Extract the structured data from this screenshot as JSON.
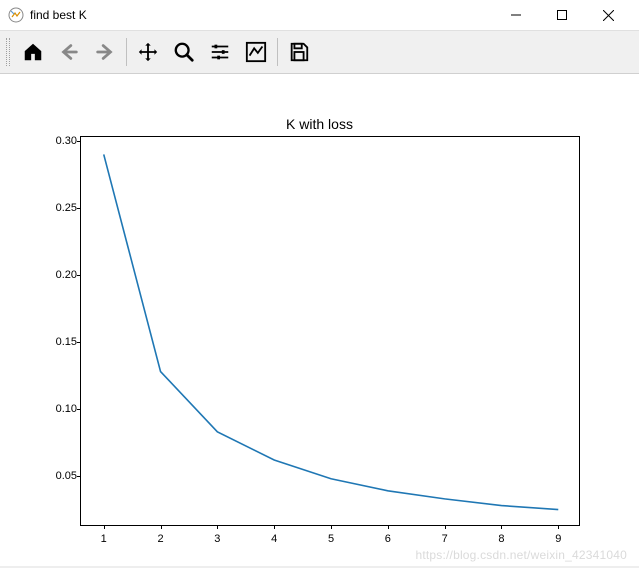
{
  "window": {
    "title": "find best K"
  },
  "toolbar": {
    "home": "home-icon",
    "back": "back-icon",
    "forward": "forward-icon",
    "pan": "pan-icon",
    "zoom": "zoom-icon",
    "subplots": "subplots-icon",
    "axes": "axes-icon",
    "save": "save-icon"
  },
  "watermark": "https://blog.csdn.net/weixin_42341040",
  "chart_data": {
    "type": "line",
    "title": "K with loss",
    "xlabel": "",
    "ylabel": "",
    "x": [
      1,
      2,
      3,
      4,
      5,
      6,
      7,
      8,
      9
    ],
    "y": [
      0.29,
      0.128,
      0.083,
      0.062,
      0.048,
      0.039,
      0.033,
      0.028,
      0.025
    ],
    "xlim": [
      0.6,
      9.4
    ],
    "ylim": [
      0.012,
      0.303
    ],
    "xticks": [
      1,
      2,
      3,
      4,
      5,
      6,
      7,
      8,
      9
    ],
    "yticks": [
      0.05,
      0.1,
      0.15,
      0.2,
      0.25,
      0.3
    ],
    "ytick_labels": [
      "0.05",
      "0.10",
      "0.15",
      "0.20",
      "0.25",
      "0.30"
    ],
    "line_color": "#1f77b4"
  }
}
